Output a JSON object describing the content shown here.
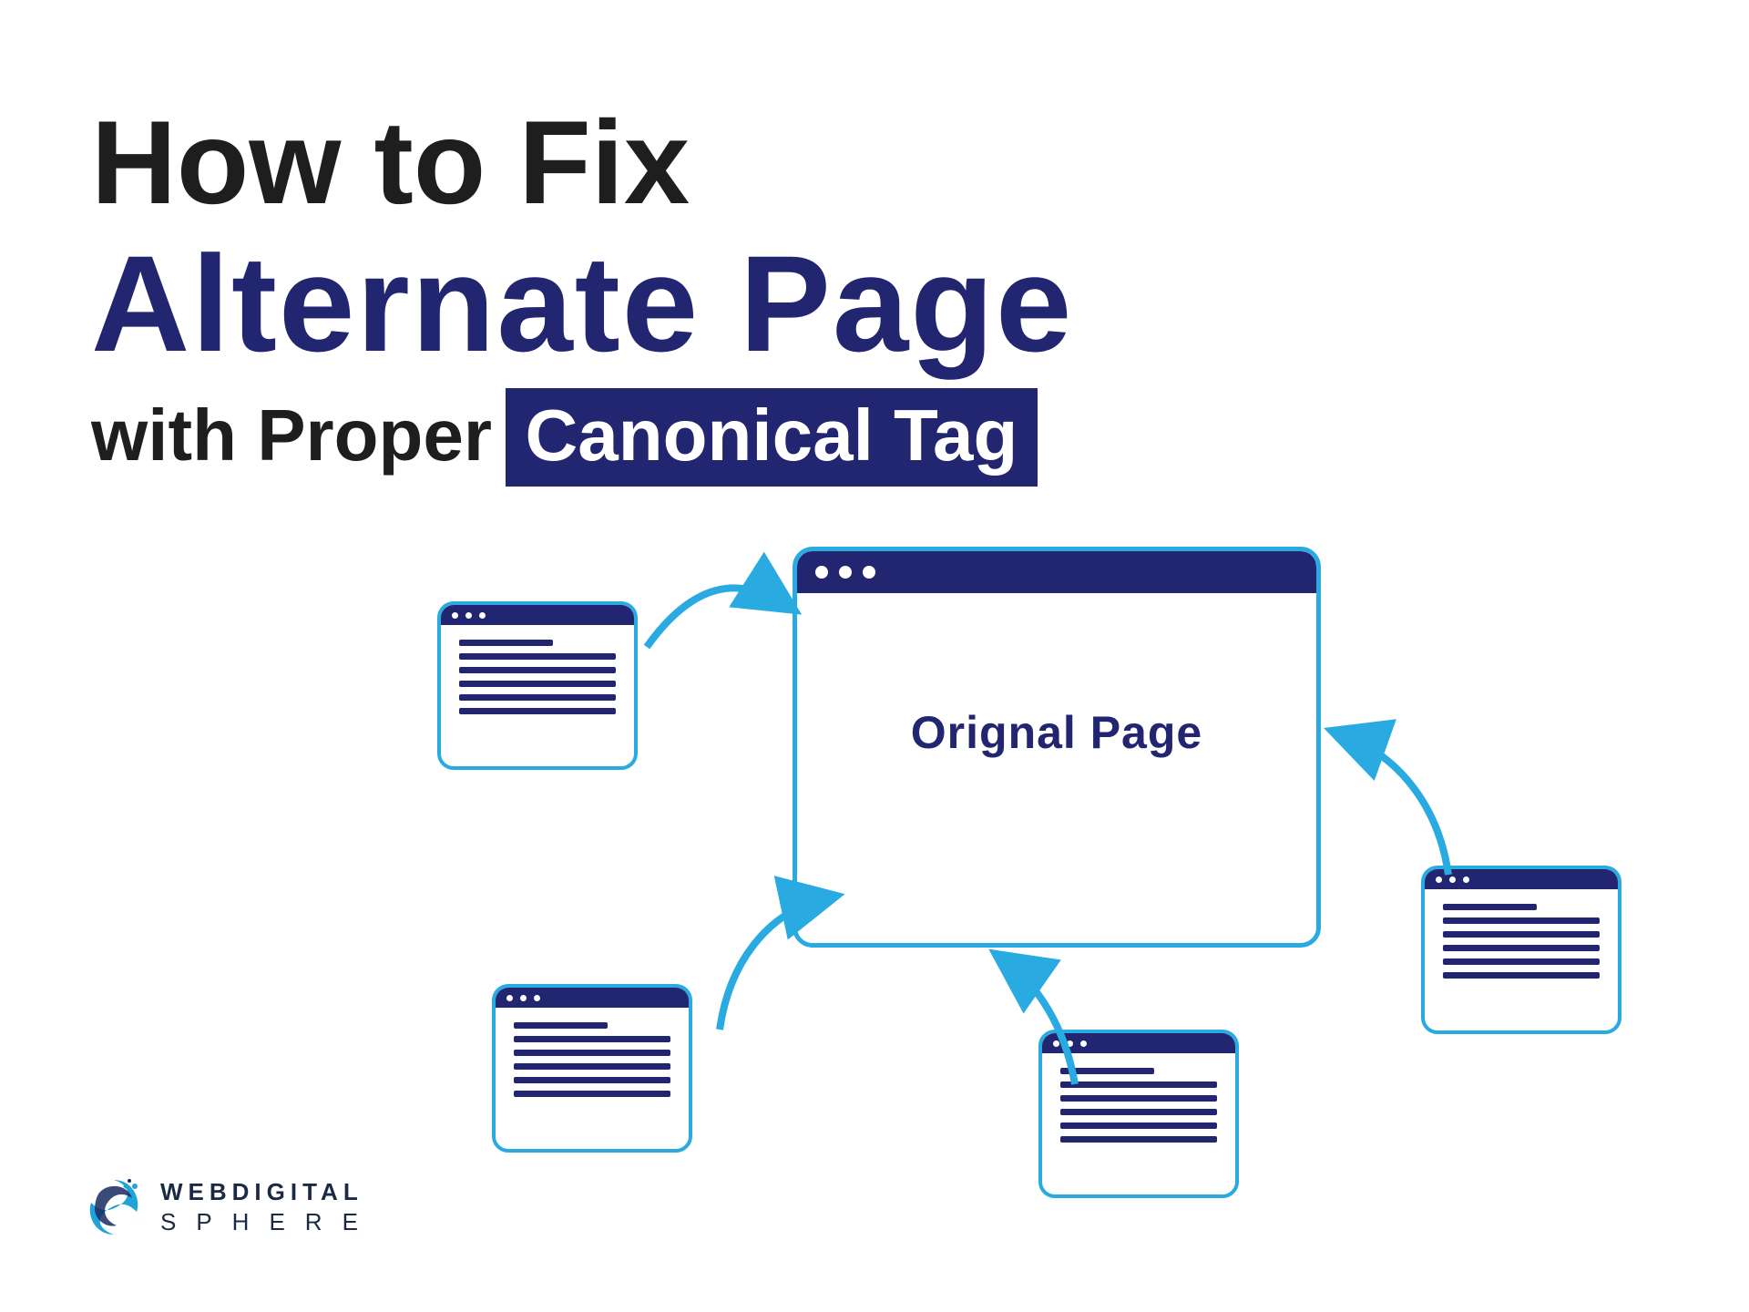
{
  "title": {
    "line1": "How to Fix",
    "line2": "Alternate Page",
    "line3_plain": "with Proper",
    "line3_highlight": "Canonical Tag"
  },
  "original_page_label": "Orignal Page",
  "logo": {
    "top": "WEBDIGITAL",
    "bottom": "SPHERE"
  },
  "colors": {
    "dark_navy": "#222570",
    "cyan_stroke": "#29abe2",
    "text_black": "#1e1e1e"
  }
}
